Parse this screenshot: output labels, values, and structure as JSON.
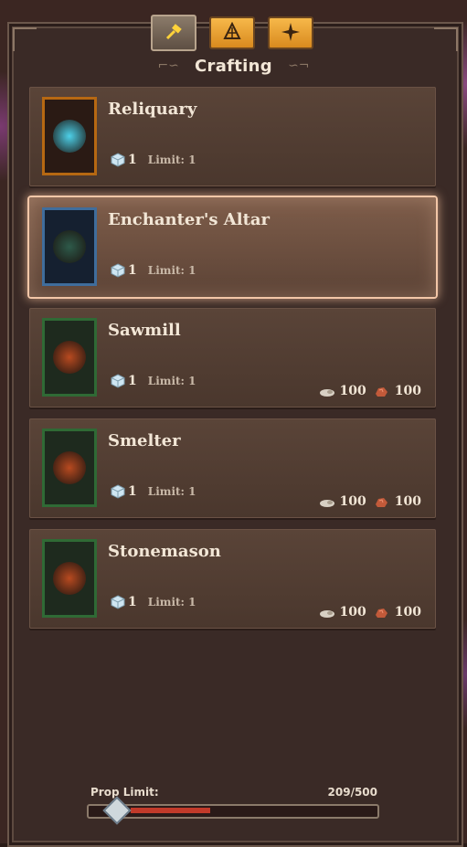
{
  "tabs": [
    {
      "name": "hammer-icon",
      "active": true
    },
    {
      "name": "altar-icon",
      "active": false
    },
    {
      "name": "star-icon",
      "active": false
    }
  ],
  "header": {
    "title": "Crafting"
  },
  "items": [
    {
      "name": "Reliquary",
      "count": "1",
      "limit": "Limit: 1",
      "costs": [],
      "frame": "orange"
    },
    {
      "name": "Enchanter's Altar",
      "count": "1",
      "limit": "Limit: 1",
      "costs": [],
      "frame": "blue",
      "selected": true
    },
    {
      "name": "Sawmill",
      "count": "1",
      "limit": "Limit: 1",
      "costs": [
        {
          "icon": "wood-icon",
          "amount": "100"
        },
        {
          "icon": "ore-icon",
          "amount": "100"
        }
      ],
      "frame": "green"
    },
    {
      "name": "Smelter",
      "count": "1",
      "limit": "Limit: 1",
      "costs": [
        {
          "icon": "wood-icon",
          "amount": "100"
        },
        {
          "icon": "ore-icon",
          "amount": "100"
        }
      ],
      "frame": "green"
    },
    {
      "name": "Stonemason",
      "count": "1",
      "limit": "Limit: 1",
      "costs": [
        {
          "icon": "wood-icon",
          "amount": "100"
        },
        {
          "icon": "ore-icon",
          "amount": "100"
        }
      ],
      "frame": "green"
    }
  ],
  "prop_limit": {
    "label": "Prop Limit:",
    "value": "209/500",
    "fraction": 0.418
  },
  "colors": {
    "selected_glow": "#f3c7a8",
    "fill": "#c23a2a",
    "tab_gold": "#f6b84a"
  }
}
